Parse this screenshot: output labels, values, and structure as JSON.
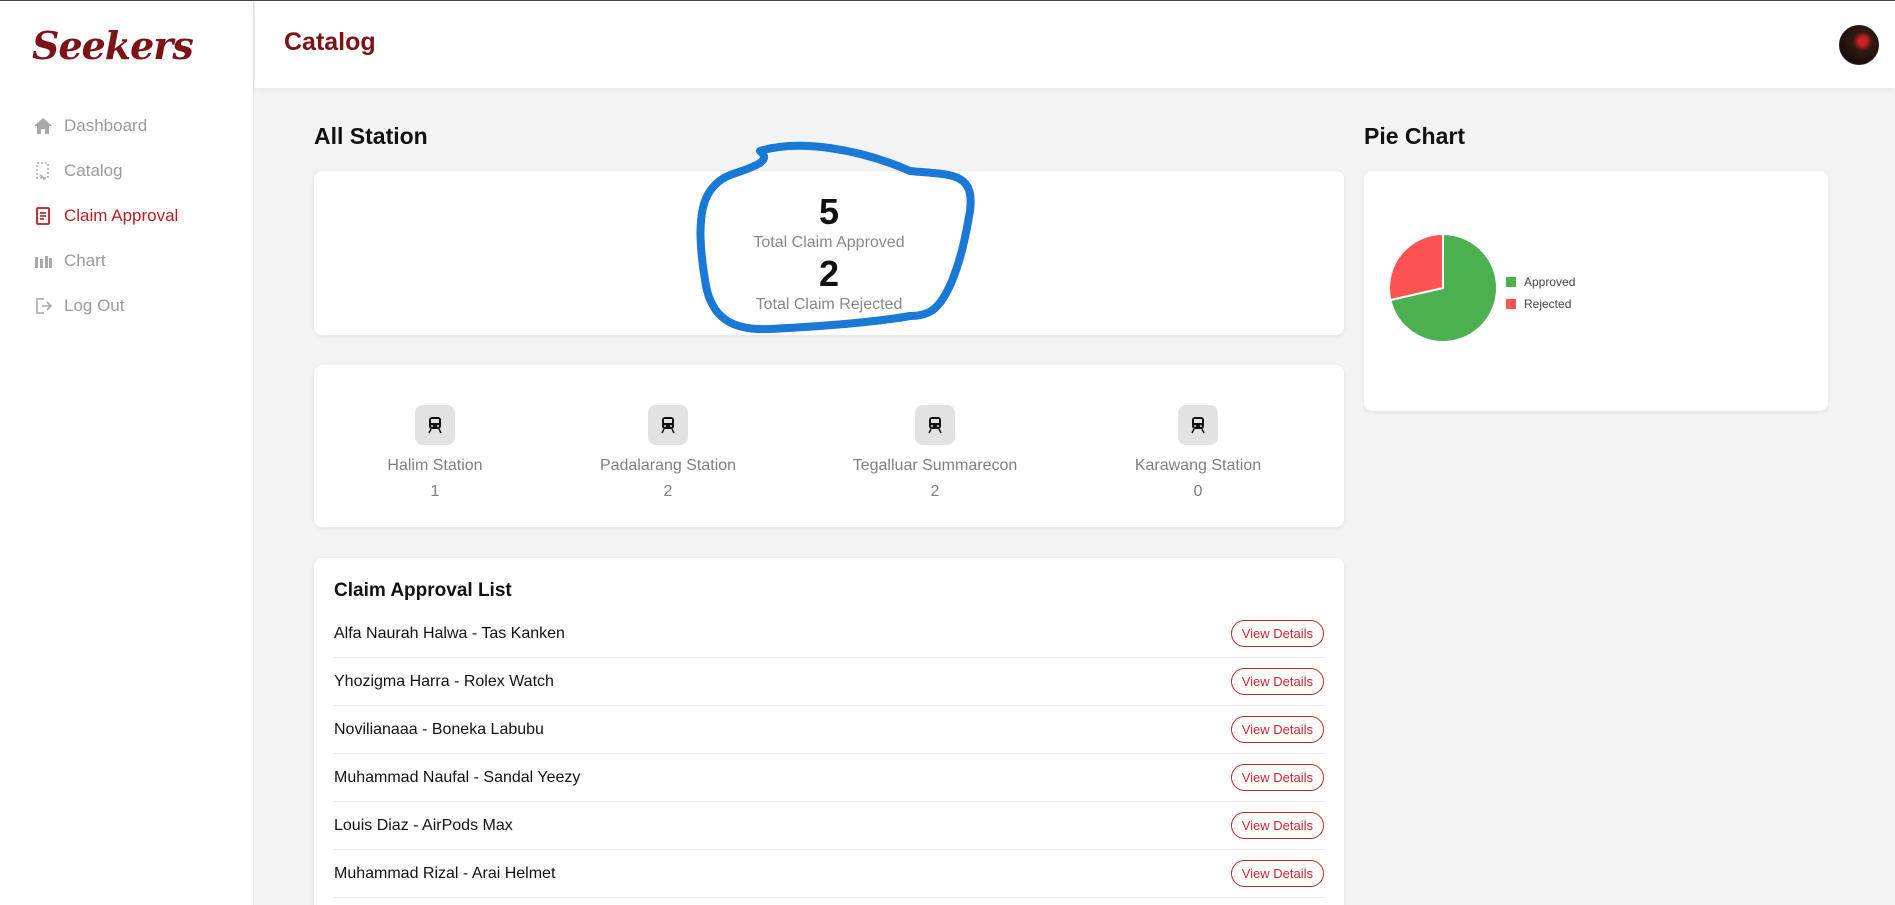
{
  "brand": {
    "logo_text": "Seekers"
  },
  "sidebar": {
    "items": [
      {
        "label": "Dashboard",
        "icon": "home-icon",
        "active": false
      },
      {
        "label": "Catalog",
        "icon": "catalog-icon",
        "active": false
      },
      {
        "label": "Claim Approval",
        "icon": "document-icon",
        "active": true
      },
      {
        "label": "Chart",
        "icon": "bar-chart-icon",
        "active": false
      },
      {
        "label": "Log Out",
        "icon": "logout-icon",
        "active": false
      }
    ]
  },
  "header": {
    "title": "Catalog"
  },
  "main": {
    "all_station_title": "All Station",
    "summary": {
      "approved_count": "5",
      "approved_label": "Total Claim Approved",
      "rejected_count": "2",
      "rejected_label": "Total Claim Rejected"
    },
    "stations": [
      {
        "name": "Halim Station",
        "count": "1"
      },
      {
        "name": "Padalarang Station",
        "count": "2"
      },
      {
        "name": "Tegalluar Summarecon",
        "count": "2"
      },
      {
        "name": "Karawang Station",
        "count": "0"
      }
    ],
    "claim_list": {
      "title": "Claim Approval List",
      "button_label": "View Details",
      "rows": [
        "Alfa Naurah Halwa - Tas Kanken",
        "Yhozigma Harra - Rolex Watch",
        "Novilianaaa - Boneka Labubu",
        "Muhammad Naufal - Sandal Yeezy",
        "Louis Diaz - AirPods Max",
        "Muhammad Rizal - Arai Helmet"
      ]
    }
  },
  "pie": {
    "title": "Pie Chart"
  },
  "chart_data": {
    "type": "pie",
    "title": "",
    "categories": [
      "Approved",
      "Rejected"
    ],
    "values": [
      5,
      2
    ],
    "colors": [
      "#4caf50",
      "#ff5252"
    ],
    "legend_position": "right"
  },
  "colors": {
    "brand": "#7a1418",
    "accent": "#b51f24",
    "annotation": "#1a78d6"
  }
}
